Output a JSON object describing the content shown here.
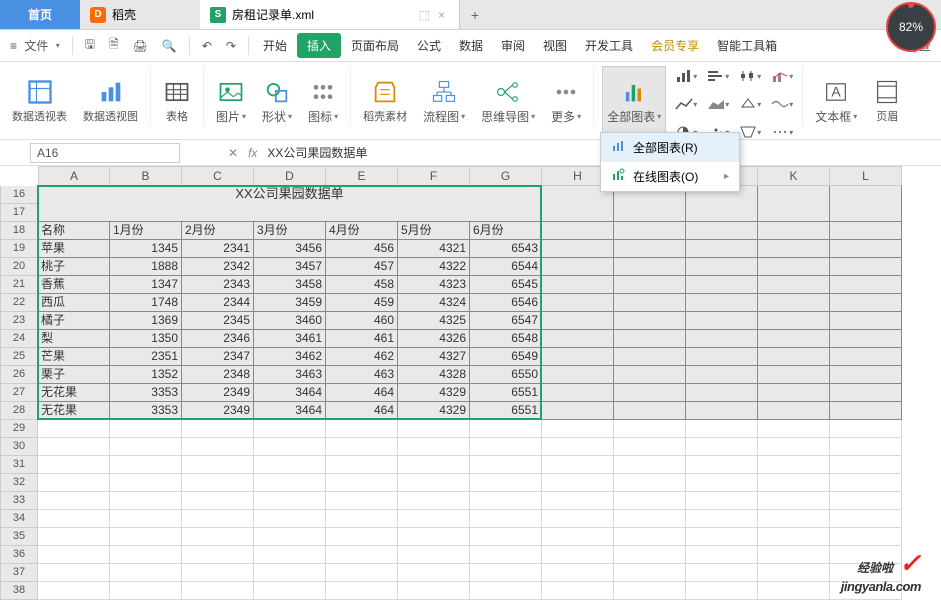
{
  "tabs": {
    "home": "首页",
    "shell": "稻壳",
    "file": "房租记录单.xml",
    "pin": "⬚",
    "close": "×",
    "add": "+"
  },
  "pct": "82%",
  "menu": {
    "file": "文件",
    "start": "开始",
    "insert": "插入",
    "page_layout": "页面布局",
    "formula": "公式",
    "data": "数据",
    "review": "审阅",
    "view": "视图",
    "dev": "开发工具",
    "member": "会员专享",
    "smart": "智能工具箱",
    "find": "查"
  },
  "ribbon": {
    "pivot_table": "数据透视表",
    "pivot_chart": "数据透视图",
    "table": "表格",
    "picture": "图片",
    "shape": "形状",
    "icon": "图标",
    "docer_material": "稻壳素材",
    "flow": "流程图",
    "mind": "思维导图",
    "more": "更多",
    "all_charts": "全部图表",
    "text_box": "文本框",
    "header_footer": "页眉"
  },
  "dropdown": {
    "all_charts": "全部图表(R)",
    "online_charts": "在线图表(O)"
  },
  "formula_bar": {
    "name": "A16",
    "fx": "fx",
    "value": "XX公司果园数据单"
  },
  "columns": [
    "A",
    "B",
    "C",
    "D",
    "E",
    "F",
    "G",
    "H",
    "I",
    "J",
    "K",
    "L"
  ],
  "row_start": 16,
  "row_count": 23,
  "title_row": "XX公司果园数据单",
  "headers": [
    "名称",
    "1月份",
    "2月份",
    "3月份",
    "4月份",
    "5月份",
    "6月份"
  ],
  "rows": [
    [
      "苹果",
      "1345",
      "2341",
      "3456",
      "456",
      "4321",
      "6543"
    ],
    [
      "桃子",
      "1888",
      "2342",
      "3457",
      "457",
      "4322",
      "6544"
    ],
    [
      "香蕉",
      "1347",
      "2343",
      "3458",
      "458",
      "4323",
      "6545"
    ],
    [
      "西瓜",
      "1748",
      "2344",
      "3459",
      "459",
      "4324",
      "6546"
    ],
    [
      "橘子",
      "1369",
      "2345",
      "3460",
      "460",
      "4325",
      "6547"
    ],
    [
      "梨",
      "1350",
      "2346",
      "3461",
      "461",
      "4326",
      "6548"
    ],
    [
      "芒果",
      "2351",
      "2347",
      "3462",
      "462",
      "4327",
      "6549"
    ],
    [
      "栗子",
      "1352",
      "2348",
      "3463",
      "463",
      "4328",
      "6550"
    ],
    [
      "无花果",
      "3353",
      "2349",
      "3464",
      "464",
      "4329",
      "6551"
    ],
    [
      "无花果",
      "3353",
      "2349",
      "3464",
      "464",
      "4329",
      "6551"
    ]
  ],
  "watermark": {
    "line1": "经验啦",
    "check": "✓",
    "line2": "jingyanla.com"
  }
}
